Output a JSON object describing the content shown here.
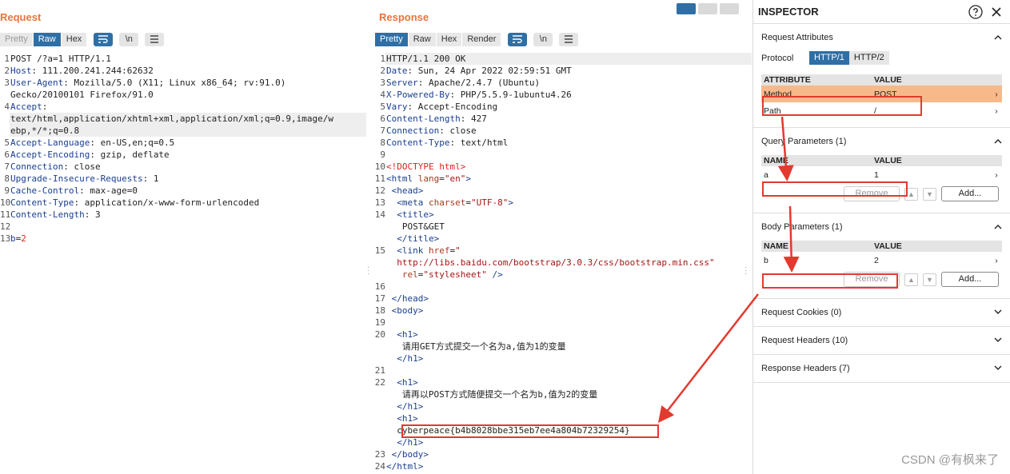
{
  "request": {
    "title": "Request",
    "tabs": [
      "Pretty",
      "Raw",
      "Hex"
    ],
    "active_tab": "Raw",
    "newline_btn": "\\n",
    "lines": [
      {
        "n": "1",
        "t": "POST /?a=1 HTTP/1.1"
      },
      {
        "n": "2",
        "k": "Host",
        "v": "111.200.241.244:62632"
      },
      {
        "n": "3",
        "k": "User-Agent",
        "v": "Mozilla/5.0 (X11; Linux x86_64; rv:91.0)"
      },
      {
        "n": "",
        "t": "Gecko/20100101 Firefox/91.0"
      },
      {
        "n": "4",
        "k": "Accept",
        "v": ""
      },
      {
        "n": "",
        "t": "text/html,application/xhtml+xml,application/xml;q=0.9,image/w"
      },
      {
        "n": "",
        "t": "ebp,*/*;q=0.8"
      },
      {
        "n": "5",
        "k": "Accept-Language",
        "v": "en-US,en;q=0.5"
      },
      {
        "n": "6",
        "k": "Accept-Encoding",
        "v": "gzip, deflate"
      },
      {
        "n": "7",
        "k": "Connection",
        "v": "close"
      },
      {
        "n": "8",
        "k": "Upgrade-Insecure-Requests",
        "v": "1"
      },
      {
        "n": "9",
        "k": "Cache-Control",
        "v": "max-age=0"
      },
      {
        "n": "10",
        "k": "Content-Type",
        "v": "application/x-www-form-urlencoded"
      },
      {
        "n": "11",
        "k": "Content-Length",
        "v": "3"
      },
      {
        "n": "12",
        "t": ""
      },
      {
        "n": "13",
        "body": "b=2"
      }
    ]
  },
  "response": {
    "title": "Response",
    "tabs": [
      "Pretty",
      "Raw",
      "Hex",
      "Render"
    ],
    "active_tab": "Pretty",
    "newline_btn": "\\n",
    "lines": [
      {
        "n": "1",
        "t": "HTTP/1.1 200 OK"
      },
      {
        "n": "2",
        "k": "Date",
        "v": "Sun, 24 Apr 2022 02:59:51 GMT"
      },
      {
        "n": "3",
        "k": "Server",
        "v": "Apache/2.4.7 (Ubuntu)"
      },
      {
        "n": "4",
        "k": "X-Powered-By",
        "v": "PHP/5.5.9-1ubuntu4.26"
      },
      {
        "n": "5",
        "k": "Vary",
        "v": "Accept-Encoding"
      },
      {
        "n": "6",
        "k": "Content-Length",
        "v": "427"
      },
      {
        "n": "7",
        "k": "Connection",
        "v": "close"
      },
      {
        "n": "8",
        "k": "Content-Type",
        "v": "text/html"
      },
      {
        "n": "9",
        "t": ""
      },
      {
        "n": "10",
        "html": "<span class='red'>&lt;!DOCTYPE html&gt;</span>"
      },
      {
        "n": "11",
        "html": "<span class='tg'>&lt;html</span> <span class='at'>lang</span>=<span class='str'>\"en\"</span><span class='tg'>&gt;</span>"
      },
      {
        "n": "12",
        "html": " <span class='tg'>&lt;head&gt;</span>"
      },
      {
        "n": "13",
        "html": "  <span class='tg'>&lt;meta</span> <span class='at'>charset</span>=<span class='str'>\"UTF-8\"</span><span class='tg'>&gt;</span>"
      },
      {
        "n": "14",
        "html": "  <span class='tg'>&lt;title&gt;</span>"
      },
      {
        "n": "",
        "t": "   POST&GET"
      },
      {
        "n": "",
        "html": "  <span class='tg'>&lt;/title&gt;</span>"
      },
      {
        "n": "15",
        "html": "  <span class='tg'>&lt;link</span> <span class='at'>href</span>=<span class='str'>\"</span>"
      },
      {
        "n": "",
        "html": "  <span class='str'>http://libs.baidu.com/bootstrap/3.0.3/css/bootstrap.min.css\"</span>"
      },
      {
        "n": "",
        "html": "   <span class='at'>rel</span>=<span class='str'>\"stylesheet\"</span> <span class='tg'>/&gt;</span>"
      },
      {
        "n": "16",
        "t": ""
      },
      {
        "n": "17",
        "html": " <span class='tg'>&lt;/head&gt;</span>"
      },
      {
        "n": "18",
        "html": " <span class='tg'>&lt;body&gt;</span>"
      },
      {
        "n": "19",
        "t": ""
      },
      {
        "n": "20",
        "html": "  <span class='tg'>&lt;h1&gt;</span>"
      },
      {
        "n": "",
        "t": "   请用GET方式提交一个名为a,值为1的变量"
      },
      {
        "n": "",
        "html": "  <span class='tg'>&lt;/h1&gt;</span>"
      },
      {
        "n": "21",
        "t": ""
      },
      {
        "n": "22",
        "html": "  <span class='tg'>&lt;h1&gt;</span>"
      },
      {
        "n": "",
        "t": "   请再以POST方式随便提交一个名为b,值为2的变量"
      },
      {
        "n": "",
        "html": "  <span class='tg'>&lt;/h1&gt;</span>"
      },
      {
        "n": "",
        "html": "  <span class='tg'>&lt;h1&gt;</span>"
      },
      {
        "n": "",
        "t": "  cyberpeace{b4b8028bbe315eb7ee4a804b72329254}",
        "flag": true
      },
      {
        "n": "",
        "html": "  <span class='tg'>&lt;/h1&gt;</span>"
      },
      {
        "n": "23",
        "html": " <span class='tg'>&lt;/body&gt;</span>"
      },
      {
        "n": "24",
        "html": "<span class='tg'>&lt;/html&gt;</span>"
      }
    ]
  },
  "inspector": {
    "title": "INSPECTOR",
    "request_attributes": {
      "label": "Request Attributes",
      "protocol_label": "Protocol",
      "protocols": [
        "HTTP/1",
        "HTTP/2"
      ],
      "col_attr": "ATTRIBUTE",
      "col_value": "VALUE",
      "rows": [
        {
          "name": "Method",
          "value": "POST"
        },
        {
          "name": "Path",
          "value": "/"
        }
      ]
    },
    "query_params": {
      "label": "Query Parameters (1)",
      "col_name": "NAME",
      "col_value": "VALUE",
      "rows": [
        {
          "name": "a",
          "value": "1"
        }
      ],
      "remove": "Remove",
      "add": "Add..."
    },
    "body_params": {
      "label": "Body Parameters (1)",
      "col_name": "NAME",
      "col_value": "VALUE",
      "rows": [
        {
          "name": "b",
          "value": "2"
        }
      ],
      "remove": "Remove",
      "add": "Add..."
    },
    "collapsed": [
      "Request Cookies (0)",
      "Request Headers (10)",
      "Response Headers (7)"
    ]
  },
  "watermark": "CSDN @有枫来了",
  "colors": {
    "accent": "#e8743b",
    "active": "#2f6fa5",
    "annotation": "#e23a2f",
    "selected_row": "#f7b98a"
  }
}
